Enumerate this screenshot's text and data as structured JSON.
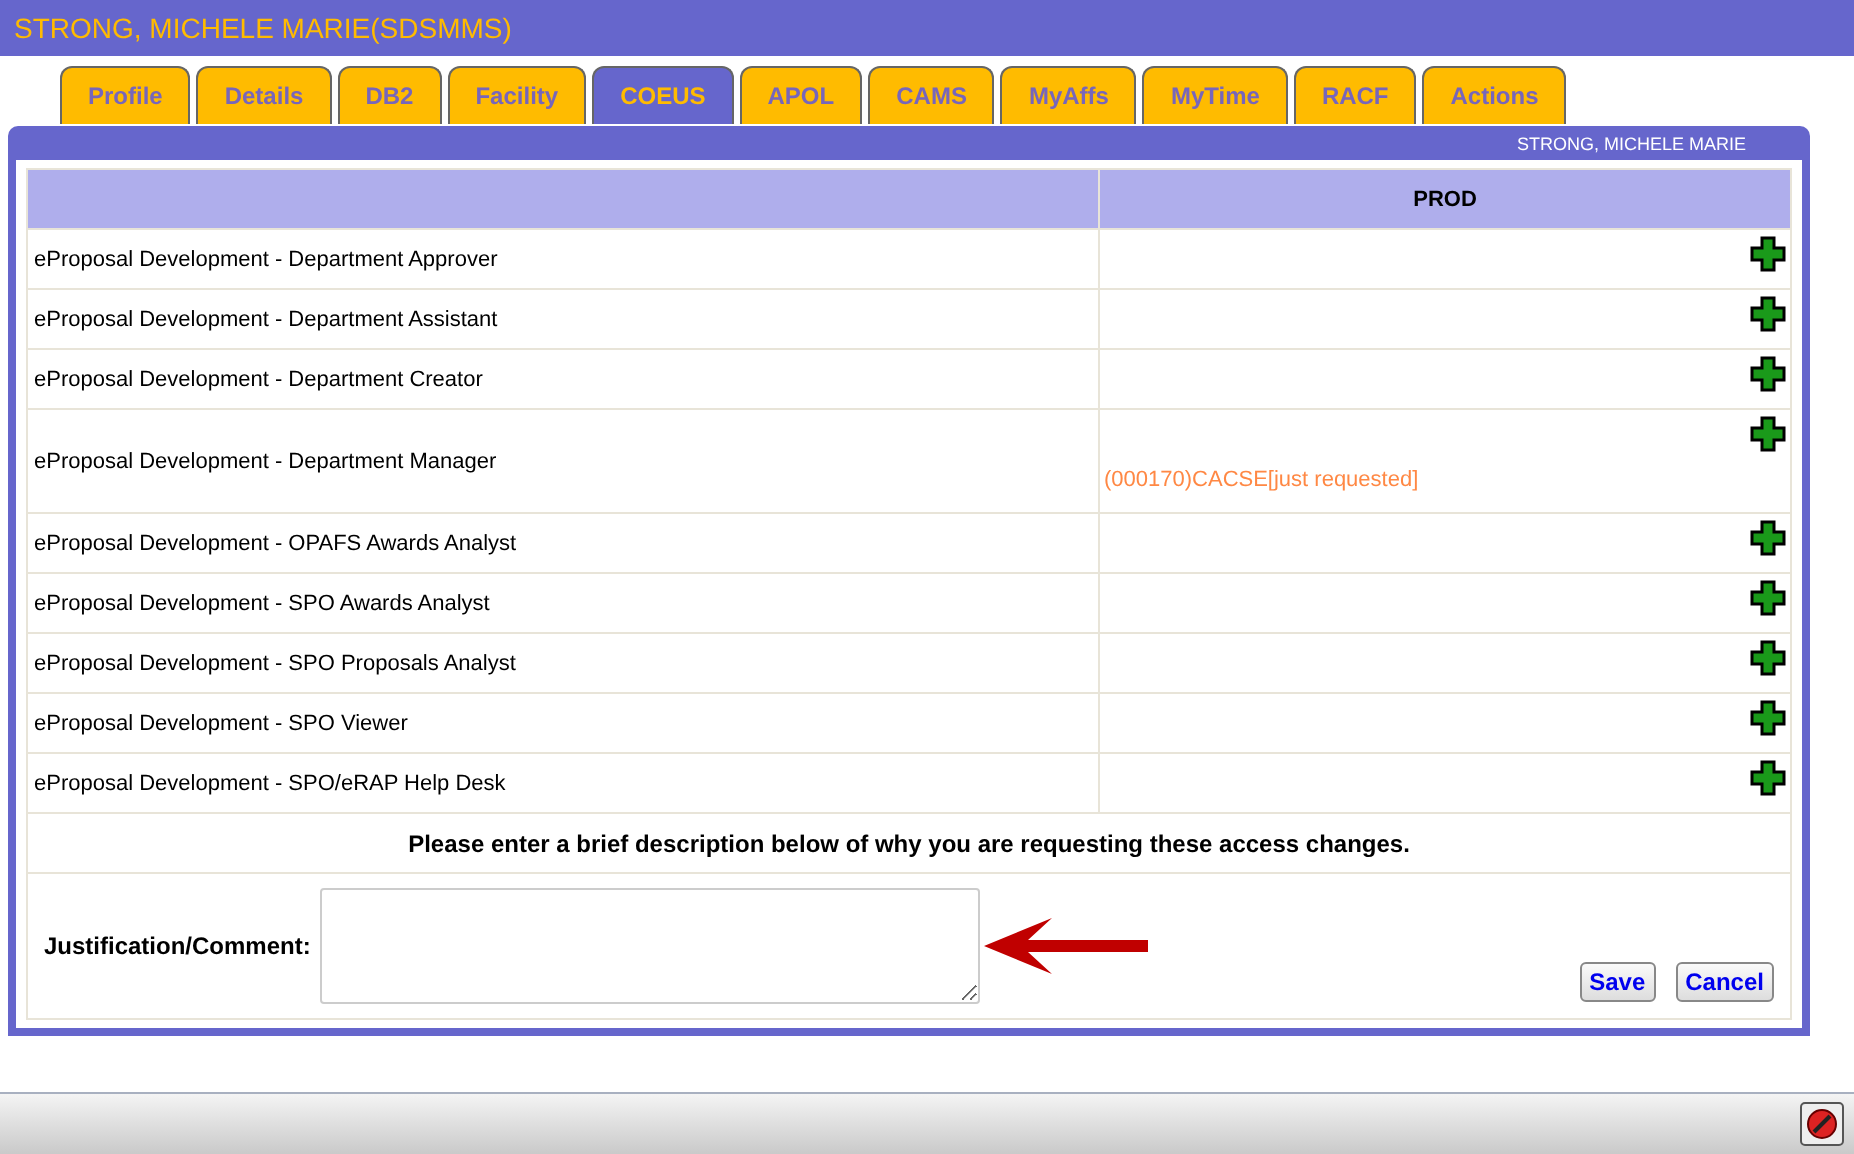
{
  "header": {
    "title": "STRONG, MICHELE MARIE(SDSMMS)"
  },
  "tabs": [
    {
      "label": "Profile",
      "selected": false
    },
    {
      "label": "Details",
      "selected": false
    },
    {
      "label": "DB2",
      "selected": false
    },
    {
      "label": "Facility",
      "selected": false
    },
    {
      "label": "COEUS",
      "selected": true
    },
    {
      "label": "APOL",
      "selected": false
    },
    {
      "label": "CAMS",
      "selected": false
    },
    {
      "label": "MyAffs",
      "selected": false
    },
    {
      "label": "MyTime",
      "selected": false
    },
    {
      "label": "RACF",
      "selected": false
    },
    {
      "label": "Actions",
      "selected": false
    }
  ],
  "panel": {
    "user_name": "STRONG, MICHELE MARIE"
  },
  "table": {
    "columns": [
      "PROD"
    ],
    "rows": [
      {
        "role": "eProposal Development - Department Approver"
      },
      {
        "role": "eProposal Development - Department Assistant"
      },
      {
        "role": "eProposal Development - Department Creator"
      },
      {
        "role": "eProposal Development - Department Manager",
        "request": "(000170)CACSE[just requested]"
      },
      {
        "role": "eProposal Development - OPAFS Awards Analyst"
      },
      {
        "role": "eProposal Development - SPO Awards Analyst"
      },
      {
        "role": "eProposal Development - SPO Proposals Analyst"
      },
      {
        "role": "eProposal Development - SPO Viewer"
      },
      {
        "role": "eProposal Development - SPO/eRAP Help Desk"
      }
    ]
  },
  "instruction": "Please enter a brief description below of why you are requesting these access changes.",
  "comment": {
    "label": "Justification/Comment:"
  },
  "buttons": [
    "Save",
    "Cancel"
  ]
}
